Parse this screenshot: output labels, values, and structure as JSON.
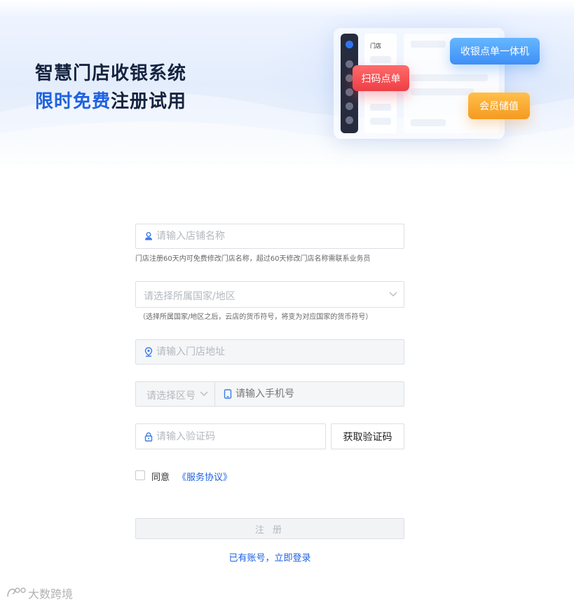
{
  "banner": {
    "headline_line1": "智慧门店收银系统",
    "headline_highlight": "限时免费",
    "headline_rest": "注册试用",
    "mockup_card_title": "门店",
    "badges": {
      "scan_order": "扫码点单",
      "pos_all_in_one": "收银点单一体机",
      "member_stored_value": "会员储值"
    }
  },
  "form": {
    "store_name": {
      "placeholder": "请输入店铺名称",
      "hint": "门店注册60天内可免费修改门店名称，超过60天修改门店名称需联系业务员"
    },
    "country": {
      "placeholder": "请选择所属国家/地区",
      "hint": "（选择所属国家/地区之后，云店的货币符号，将变为对应国家的货币符号）"
    },
    "address": {
      "placeholder": "请输入门店地址"
    },
    "area_code": {
      "placeholder": "请选择区号"
    },
    "phone": {
      "placeholder": "请输入手机号"
    },
    "verification_code": {
      "placeholder": "请输入验证码",
      "button_label": "获取验证码"
    },
    "agreement": {
      "prefix": "同意",
      "link_text": "《服务协议》",
      "checked": false
    },
    "register_label": "注 册",
    "login_link": "已有账号，立即登录"
  },
  "watermark": "大数跨境",
  "colors": {
    "brand_blue": "#1e62e0",
    "headline_dark": "#15233f",
    "badge_red": "#ee3e46",
    "badge_blue": "#3e8ff6",
    "badge_orange": "#f59a21",
    "disabled_bg": "#f5f6f7"
  },
  "icons": {
    "store_name": "user-icon",
    "country": "chevron-down-icon",
    "address": "location-pin-icon",
    "phone": "phone-icon",
    "verification_code": "lock-icon"
  }
}
